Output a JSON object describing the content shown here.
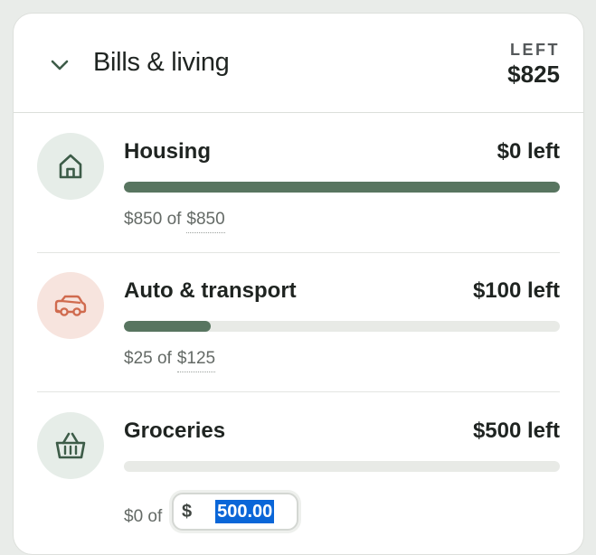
{
  "group": {
    "title": "Bills & living",
    "left_label": "LEFT",
    "left_amount": "$825"
  },
  "categories": [
    {
      "name": "Housing",
      "left": "$0 left",
      "spent": "$850",
      "of": "of",
      "budget": "$850",
      "progress": 1.0,
      "icon": "house-icon",
      "icon_color": "#3d5c48",
      "icon_bg": "#e6ede8"
    },
    {
      "name": "Auto & transport",
      "left": "$100 left",
      "spent": "$25",
      "of": "of",
      "budget": "$125",
      "progress": 0.2,
      "icon": "car-icon",
      "icon_color": "#d06b4f",
      "icon_bg": "#f7e4de"
    },
    {
      "name": "Groceries",
      "left": "$500 left",
      "spent": "$0",
      "of": "of",
      "budget_currency": "$",
      "budget_value": "500.00",
      "progress": 0.0,
      "icon": "basket-icon",
      "icon_color": "#3d5c48",
      "icon_bg": "#e6ede8"
    }
  ],
  "colors": {
    "progress_fill": "#587560",
    "progress_track": "#e8eae6",
    "selection": "#0a66d8"
  }
}
